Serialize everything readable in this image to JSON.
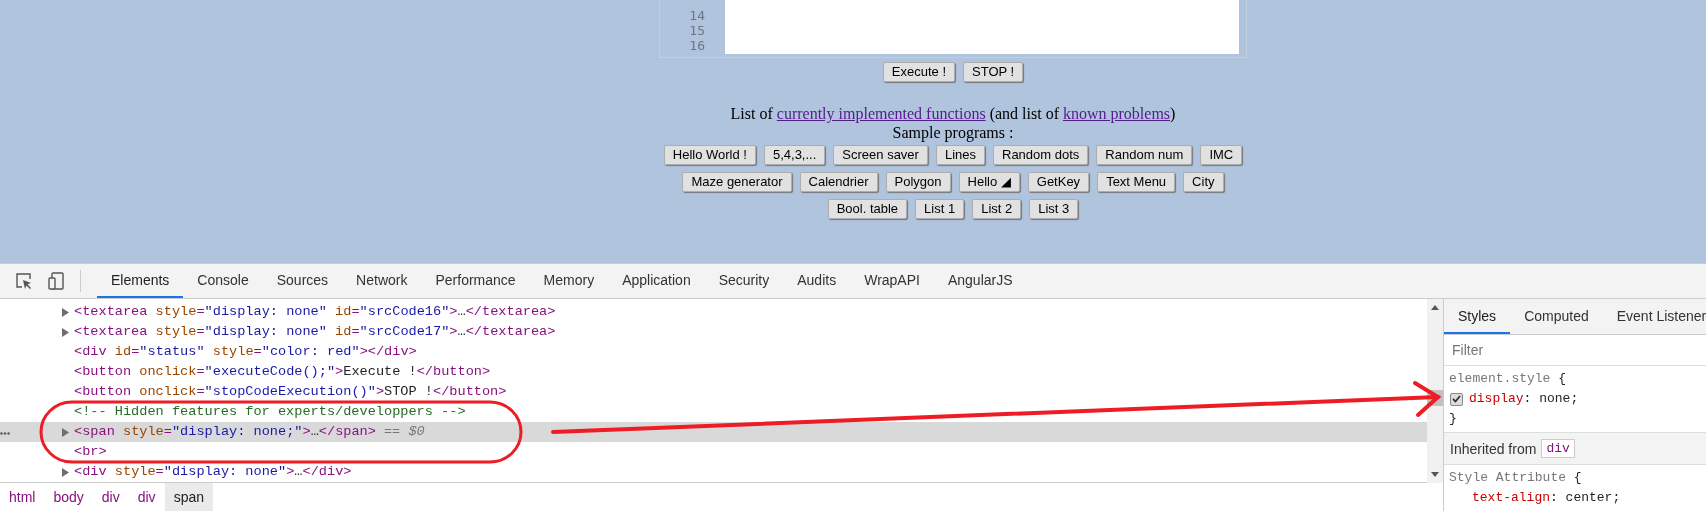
{
  "editor": {
    "line_numbers": [
      "14",
      "15",
      "16"
    ]
  },
  "run_buttons": [
    "Execute !",
    "STOP !"
  ],
  "functions_note": [
    {
      "kind": "text",
      "text": "List of "
    },
    {
      "kind": "link",
      "text": "currently implemented functions"
    },
    {
      "kind": "text",
      "text": " (and list of "
    },
    {
      "kind": "link",
      "text": "known problems"
    },
    {
      "kind": "text",
      "text": ")"
    }
  ],
  "samples_label": "Sample programs :",
  "sample_rows": [
    [
      "Hello World !",
      "5,4,3,...",
      "Screen saver",
      "Lines",
      "Random dots",
      "Random num",
      "IMC"
    ],
    [
      "Maze generator",
      "Calendrier",
      "Polygon",
      "Hello ◢",
      "GetKey",
      "Text Menu",
      "City"
    ],
    [
      "Bool. table",
      "List 1",
      "List 2",
      "List 3"
    ]
  ],
  "devtools": {
    "tabs": [
      {
        "label": "Elements",
        "selected": true
      },
      {
        "label": "Console",
        "selected": false
      },
      {
        "label": "Sources",
        "selected": false
      },
      {
        "label": "Network",
        "selected": false
      },
      {
        "label": "Performance",
        "selected": false
      },
      {
        "label": "Memory",
        "selected": false
      },
      {
        "label": "Application",
        "selected": false
      },
      {
        "label": "Security",
        "selected": false
      },
      {
        "label": "Audits",
        "selected": false
      },
      {
        "label": "WrapAPI",
        "selected": false
      },
      {
        "label": "AngularJS",
        "selected": false
      }
    ],
    "dom_lines": [
      {
        "kind": "element",
        "expandable": true,
        "selected": false,
        "code": "<textarea style=\"display: none\" id=\"srcCode16\">…</textarea>"
      },
      {
        "kind": "element",
        "expandable": true,
        "selected": false,
        "code": "<textarea style=\"display: none\" id=\"srcCode17\">…</textarea>"
      },
      {
        "kind": "element",
        "expandable": false,
        "selected": false,
        "code": "<div id=\"status\" style=\"color: red\"></div>"
      },
      {
        "kind": "element",
        "expandable": false,
        "selected": false,
        "code": "<button onclick=\"executeCode();\">Execute !</button>"
      },
      {
        "kind": "element",
        "expandable": false,
        "selected": false,
        "code": "<button onclick=\"stopCodeExecution()\">STOP !</button>"
      },
      {
        "kind": "comment",
        "expandable": false,
        "selected": false,
        "code": "<!-- Hidden features for experts/developpers -->"
      },
      {
        "kind": "element",
        "expandable": true,
        "selected": true,
        "code": "<span style=\"display: none;\">…</span>",
        "console_ref": "== $0"
      },
      {
        "kind": "element",
        "expandable": false,
        "selected": false,
        "code": "<br>"
      },
      {
        "kind": "element",
        "expandable": true,
        "selected": false,
        "code": "<div style=\"display: none\">…</div>"
      }
    ],
    "breadcrumbs": [
      {
        "label": "html",
        "selected": false
      },
      {
        "label": "body",
        "selected": false
      },
      {
        "label": "div",
        "selected": false
      },
      {
        "label": "div",
        "selected": false
      },
      {
        "label": "span",
        "selected": true
      }
    ],
    "styles_pane": {
      "tabs": [
        {
          "label": "Styles",
          "selected": true
        },
        {
          "label": "Computed",
          "selected": false
        },
        {
          "label": "Event Listener",
          "selected": false
        }
      ],
      "filter_placeholder": "Filter",
      "element_style": {
        "header": "element.style {",
        "properties": [
          {
            "text": "display: none;",
            "checked": true
          }
        ],
        "footer": "}"
      },
      "inherited": {
        "label": "Inherited from",
        "element": "div"
      },
      "style_attribute": {
        "header": "Style Attribute {",
        "properties": [
          {
            "text": "text-align: center;"
          }
        ]
      }
    }
  }
}
